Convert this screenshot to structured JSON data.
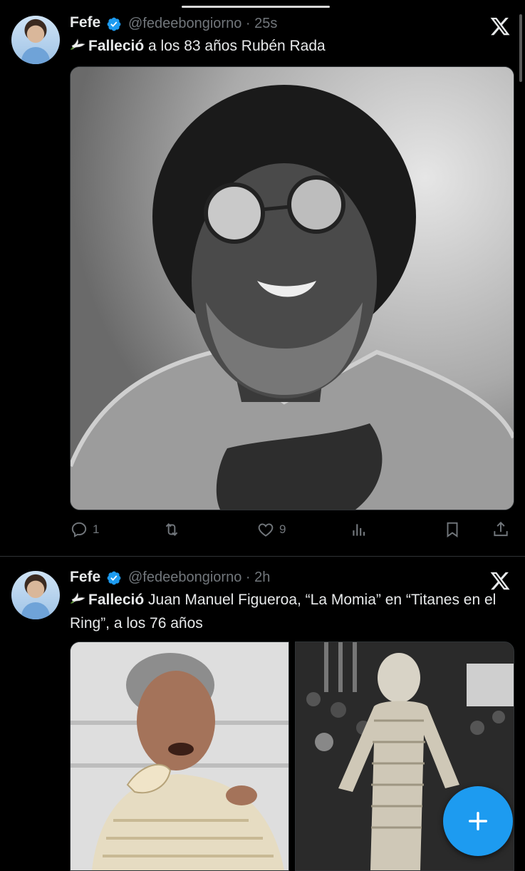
{
  "tweets": [
    {
      "name": "Fefe",
      "handle": "@fedeebongiorno",
      "time": "· 25s",
      "text_bold": "Falleció",
      "text_rest": " a los 83 años Rubén Rada",
      "actions": {
        "replies": "1",
        "retweets": "",
        "likes": "9"
      }
    },
    {
      "name": "Fefe",
      "handle": "@fedeebongiorno",
      "time": "· 2h",
      "text_bold": "Falleció",
      "text_rest": " Juan Manuel Figueroa, “La Momia” en “Titanes en el Ring”, a los 76 años"
    }
  ],
  "icons": {
    "verified": "verified-badge-icon",
    "x_logo": "x-logo-icon",
    "dove": "dove-emoji-icon",
    "reply": "reply-icon",
    "retweet": "retweet-icon",
    "like": "heart-icon",
    "views": "views-icon",
    "bookmark": "bookmark-icon",
    "share": "share-icon",
    "compose": "plus-icon"
  },
  "colors": {
    "background": "#000000",
    "text": "#e7e9ea",
    "secondary": "#71767b",
    "accent": "#1d9bf0"
  }
}
